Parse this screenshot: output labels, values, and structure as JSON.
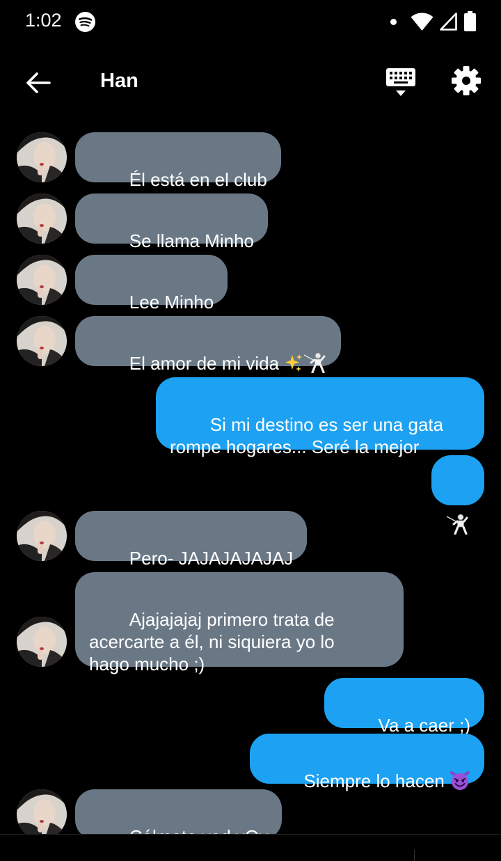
{
  "status_bar": {
    "time": "1:02",
    "icons": [
      "spotify-icon",
      "notification-dot-icon",
      "wifi-icon",
      "cell-signal-icon",
      "battery-icon"
    ]
  },
  "header": {
    "title": "Han",
    "back_icon": "arrow-left-icon",
    "keyboard_icon": "keyboard-icon",
    "settings_icon": "gear-icon"
  },
  "colors": {
    "incoming_bubble": "#6a7886",
    "outgoing_bubble": "#1da1f2",
    "background": "#000000"
  },
  "messages": [
    {
      "direction": "in",
      "text": "Él está en el club"
    },
    {
      "direction": "in",
      "text": "Se llama Minho"
    },
    {
      "direction": "in",
      "text": "Lee Minho"
    },
    {
      "direction": "in",
      "text": "El amor de mi vida ",
      "emojis": [
        "sparkles",
        "fencer"
      ]
    },
    {
      "direction": "out",
      "text": "Si mi destino es ser una gata\nrompe hogares... Seré la mejor"
    },
    {
      "direction": "out",
      "text": "",
      "emojis": [
        "fencer"
      ]
    },
    {
      "direction": "in",
      "text": "Pero- JAJAJAJAJAJ"
    },
    {
      "direction": "in",
      "text": "Ajajajajaj primero trata de\nacercarte a él, ni siquiera yo lo\nhago mucho ;)"
    },
    {
      "direction": "out",
      "text": "Va a caer ;)"
    },
    {
      "direction": "out",
      "text": "Siempre lo hacen ",
      "emojis": [
        "smiling-imp"
      ]
    },
    {
      "direction": "in",
      "text": "Cálmate vad vOy"
    }
  ]
}
